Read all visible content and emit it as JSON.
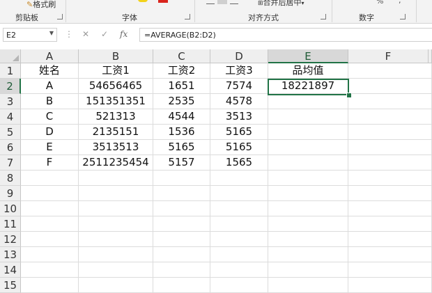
{
  "ribbon": {
    "format_painter_label": "格式刷",
    "clipboard_group": "剪贴板",
    "font_group": "字体",
    "alignment_group": "对齐方式",
    "merge_center_label": "合并后居中",
    "number_group": "数字",
    "percent_symbol": "%",
    "comma_symbol": ","
  },
  "formula_bar": {
    "name_box": "E2",
    "formula": "=AVERAGE(B2:D2)",
    "fx_label": "fx"
  },
  "sheet": {
    "selected_cell": "E2",
    "columns": [
      "A",
      "B",
      "C",
      "D",
      "E",
      "F"
    ],
    "row_numbers": [
      "1",
      "2",
      "3",
      "4",
      "5",
      "6",
      "7",
      "8",
      "9",
      "10",
      "11",
      "12",
      "13",
      "14",
      "15"
    ],
    "rows": [
      [
        "姓名",
        "工资1",
        "工资2",
        "工资3",
        "品均值",
        ""
      ],
      [
        "A",
        "54656465",
        "1651",
        "7574",
        "18221897",
        ""
      ],
      [
        "B",
        "151351351",
        "2535",
        "4578",
        "",
        ""
      ],
      [
        "C",
        "521313",
        "4544",
        "3513",
        "",
        ""
      ],
      [
        "D",
        "2135151",
        "1536",
        "5165",
        "",
        ""
      ],
      [
        "E",
        "3513513",
        "5165",
        "5165",
        "",
        ""
      ],
      [
        "F",
        "2511235454",
        "5157",
        "1565",
        "",
        ""
      ]
    ]
  },
  "colors": {
    "accent": "#217346"
  }
}
